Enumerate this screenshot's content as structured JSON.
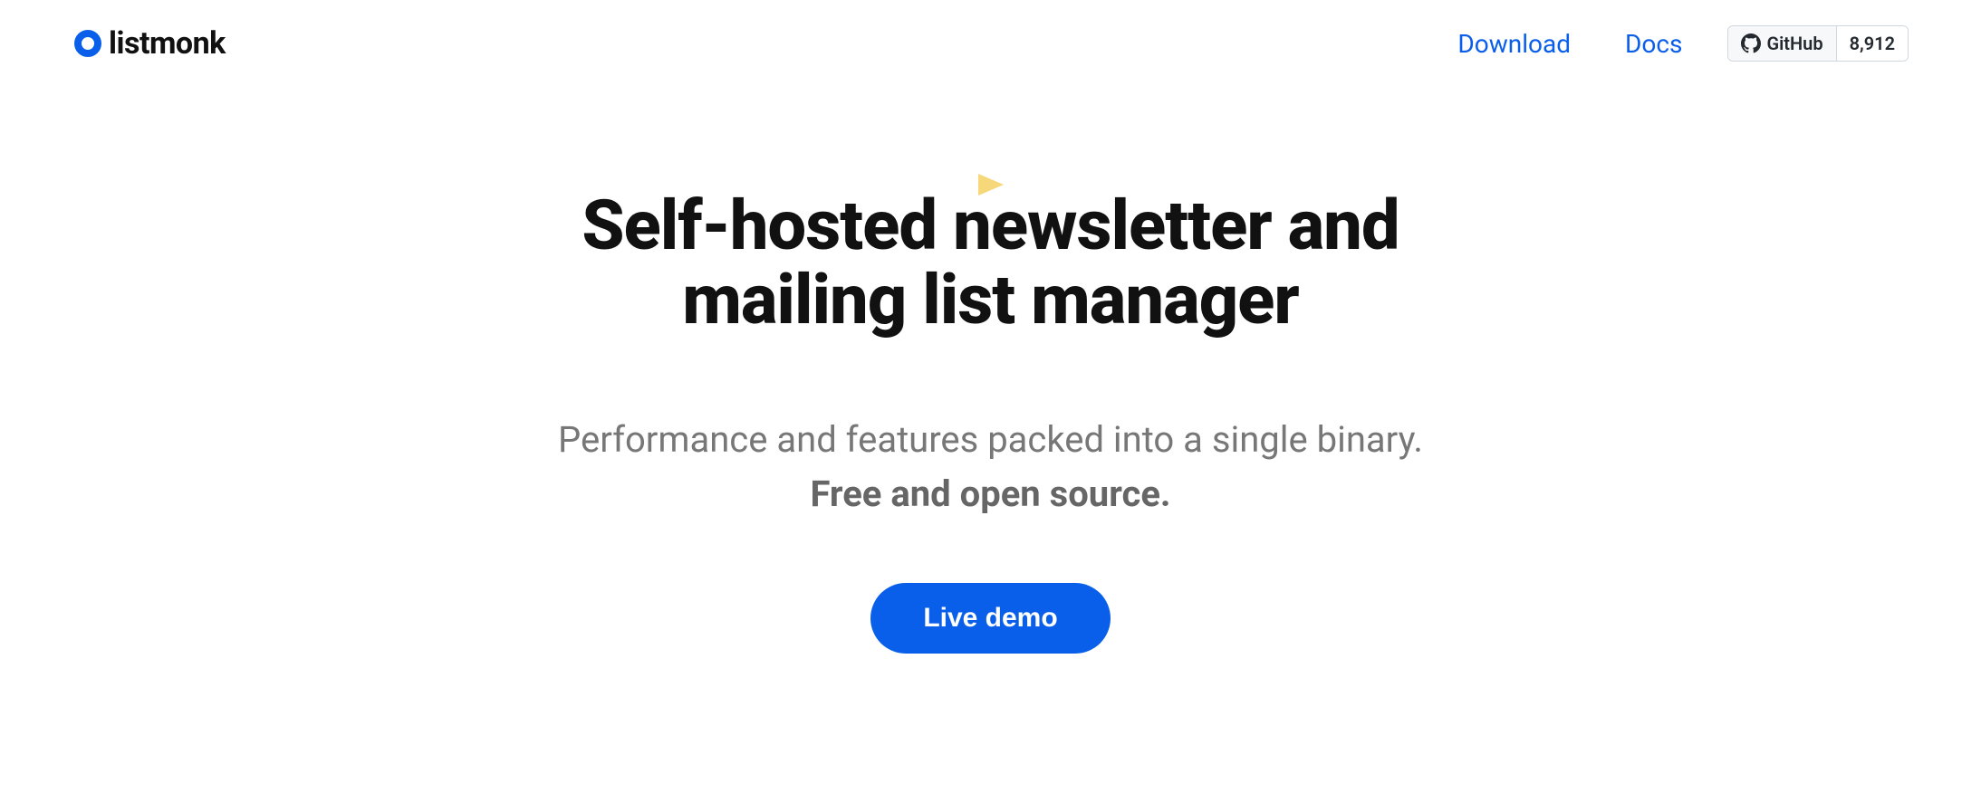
{
  "brand": {
    "name": "listmonk"
  },
  "nav": {
    "download": "Download",
    "docs": "Docs",
    "github_label": "GitHub",
    "github_count": "8,912"
  },
  "hero": {
    "headline_line1": "Self-hosted newsletter and",
    "headline_line2": "mailing list manager",
    "subline": "Performance and features packed into a single binary.",
    "subline_strong": "Free and open source.",
    "cta_label": "Live demo"
  }
}
